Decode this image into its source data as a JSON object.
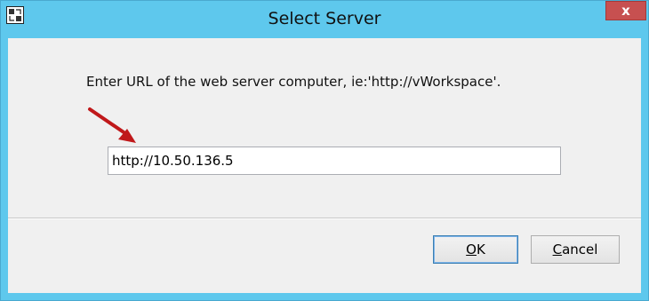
{
  "window": {
    "title": "Select Server",
    "app_icon": "dialog-app-icon",
    "close_glyph": "x"
  },
  "dialog": {
    "prompt": "Enter URL of the web server computer, ie:'http://vWorkspace'.",
    "url_value": "http://10.50.136.5",
    "annotation_arrow": "red-arrow-icon",
    "arrow_color": "#c0181a"
  },
  "buttons": {
    "ok_mnemonic": "O",
    "ok_rest": "K",
    "cancel_mnemonic": "C",
    "cancel_rest": "ancel"
  },
  "colors": {
    "titlebar": "#5ec8ed",
    "close": "#c75050",
    "client": "#f0f0f0"
  }
}
